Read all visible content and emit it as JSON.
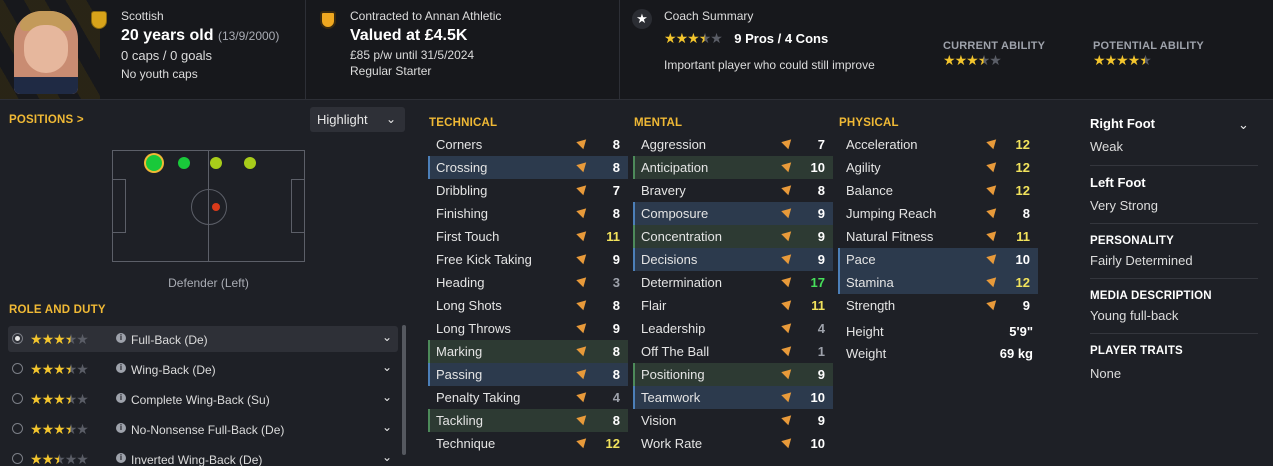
{
  "header": {
    "nationality": "Scottish",
    "age": "20 years old",
    "dob": "(13/9/2000)",
    "caps_goals": "0 caps / 0 goals",
    "youth_caps": "No youth caps",
    "contract": "Contracted to Annan Athletic",
    "valuation": "Valued at £4.5K",
    "wage": "£85 p/w until 31/5/2024",
    "squad_status": "Regular Starter",
    "coach_summary_label": "Coach Summary",
    "coach_stars": 3.5,
    "pros_cons": "9 Pros / 4 Cons",
    "coach_comment": "Important player who could still improve",
    "current_ability_label": "CURRENT ABILITY",
    "current_ability_stars": 3.5,
    "potential_ability_label": "POTENTIAL ABILITY",
    "potential_ability_stars": 4.5
  },
  "positions": {
    "title": "POSITIONS",
    "title_arrow": ">",
    "highlight_label": "Highlight",
    "position_label": "Defender (Left)",
    "dots": [
      {
        "row": "top",
        "slot": 1,
        "color": "#19c93a",
        "selected": true
      },
      {
        "row": "top",
        "slot": 2,
        "color": "#19c93a",
        "selected": false
      },
      {
        "row": "top",
        "slot": 3,
        "color": "#a8cc1a",
        "selected": false
      },
      {
        "row": "top",
        "slot": 4,
        "color": "#a8cc1a",
        "selected": false
      },
      {
        "row": "centre",
        "slot": 1,
        "color": "#d93a1a",
        "selected": false
      }
    ]
  },
  "roles": {
    "title": "ROLE AND DUTY",
    "items": [
      {
        "label": "Full-Back (De)",
        "stars": 3.5,
        "selected": true
      },
      {
        "label": "Wing-Back (De)",
        "stars": 3.5,
        "selected": false
      },
      {
        "label": "Complete Wing-Back (Su)",
        "stars": 3.5,
        "selected": false
      },
      {
        "label": "No-Nonsense Full-Back (De)",
        "stars": 3.5,
        "selected": false
      },
      {
        "label": "Inverted Wing-Back (De)",
        "stars": 2.5,
        "selected": false
      }
    ]
  },
  "technical": {
    "title": "TECHNICAL",
    "rows": [
      {
        "name": "Corners",
        "value": "8",
        "tone": "white",
        "hl": ""
      },
      {
        "name": "Crossing",
        "value": "8",
        "tone": "white",
        "hl": "key"
      },
      {
        "name": "Dribbling",
        "value": "7",
        "tone": "white",
        "hl": ""
      },
      {
        "name": "Finishing",
        "value": "8",
        "tone": "white",
        "hl": ""
      },
      {
        "name": "First Touch",
        "value": "11",
        "tone": "yellow",
        "hl": ""
      },
      {
        "name": "Free Kick Taking",
        "value": "9",
        "tone": "white",
        "hl": ""
      },
      {
        "name": "Heading",
        "value": "3",
        "tone": "grey",
        "hl": ""
      },
      {
        "name": "Long Shots",
        "value": "8",
        "tone": "white",
        "hl": ""
      },
      {
        "name": "Long Throws",
        "value": "9",
        "tone": "white",
        "hl": ""
      },
      {
        "name": "Marking",
        "value": "8",
        "tone": "white",
        "hl": "pref"
      },
      {
        "name": "Passing",
        "value": "8",
        "tone": "white",
        "hl": "key"
      },
      {
        "name": "Penalty Taking",
        "value": "4",
        "tone": "grey",
        "hl": ""
      },
      {
        "name": "Tackling",
        "value": "8",
        "tone": "white",
        "hl": "pref"
      },
      {
        "name": "Technique",
        "value": "12",
        "tone": "yellow",
        "hl": ""
      }
    ]
  },
  "mental": {
    "title": "MENTAL",
    "rows": [
      {
        "name": "Aggression",
        "value": "7",
        "tone": "white",
        "hl": ""
      },
      {
        "name": "Anticipation",
        "value": "10",
        "tone": "white",
        "hl": "pref"
      },
      {
        "name": "Bravery",
        "value": "8",
        "tone": "white",
        "hl": ""
      },
      {
        "name": "Composure",
        "value": "9",
        "tone": "white",
        "hl": "key"
      },
      {
        "name": "Concentration",
        "value": "9",
        "tone": "white",
        "hl": "pref"
      },
      {
        "name": "Decisions",
        "value": "9",
        "tone": "white",
        "hl": "key"
      },
      {
        "name": "Determination",
        "value": "17",
        "tone": "green",
        "hl": ""
      },
      {
        "name": "Flair",
        "value": "11",
        "tone": "yellow",
        "hl": ""
      },
      {
        "name": "Leadership",
        "value": "4",
        "tone": "grey",
        "hl": ""
      },
      {
        "name": "Off The Ball",
        "value": "1",
        "tone": "grey",
        "hl": ""
      },
      {
        "name": "Positioning",
        "value": "9",
        "tone": "white",
        "hl": "pref"
      },
      {
        "name": "Teamwork",
        "value": "10",
        "tone": "white",
        "hl": "key"
      },
      {
        "name": "Vision",
        "value": "9",
        "tone": "white",
        "hl": ""
      },
      {
        "name": "Work Rate",
        "value": "10",
        "tone": "white",
        "hl": ""
      }
    ]
  },
  "physical": {
    "title": "PHYSICAL",
    "rows": [
      {
        "name": "Acceleration",
        "value": "12",
        "tone": "yellow",
        "hl": ""
      },
      {
        "name": "Agility",
        "value": "12",
        "tone": "yellow",
        "hl": ""
      },
      {
        "name": "Balance",
        "value": "12",
        "tone": "yellow",
        "hl": ""
      },
      {
        "name": "Jumping Reach",
        "value": "8",
        "tone": "white",
        "hl": ""
      },
      {
        "name": "Natural Fitness",
        "value": "11",
        "tone": "yellow",
        "hl": ""
      },
      {
        "name": "Pace",
        "value": "10",
        "tone": "white",
        "hl": "key"
      },
      {
        "name": "Stamina",
        "value": "12",
        "tone": "yellow",
        "hl": "key"
      },
      {
        "name": "Strength",
        "value": "9",
        "tone": "white",
        "hl": ""
      }
    ],
    "height_label": "Height",
    "height_value": "5'9\"",
    "weight_label": "Weight",
    "weight_value": "69 kg"
  },
  "details": {
    "right_foot_label": "Right Foot",
    "right_foot_value": "Weak",
    "left_foot_label": "Left Foot",
    "left_foot_value": "Very Strong",
    "personality_label": "PERSONALITY",
    "personality_value": "Fairly Determined",
    "media_label": "MEDIA DESCRIPTION",
    "media_value": "Young full-back",
    "traits_label": "PLAYER TRAITS",
    "traits_value": "None"
  },
  "colors": {
    "accent": "#f0b935",
    "key_attr": "#2c3a4d",
    "pref_attr": "#2d3a33",
    "arrow": "#e89a3a"
  },
  "icons": [
    "scotland-flag-icon",
    "club-crest-icon",
    "star-icon",
    "chevron-down-icon",
    "info-icon",
    "arrow-up-icon"
  ]
}
